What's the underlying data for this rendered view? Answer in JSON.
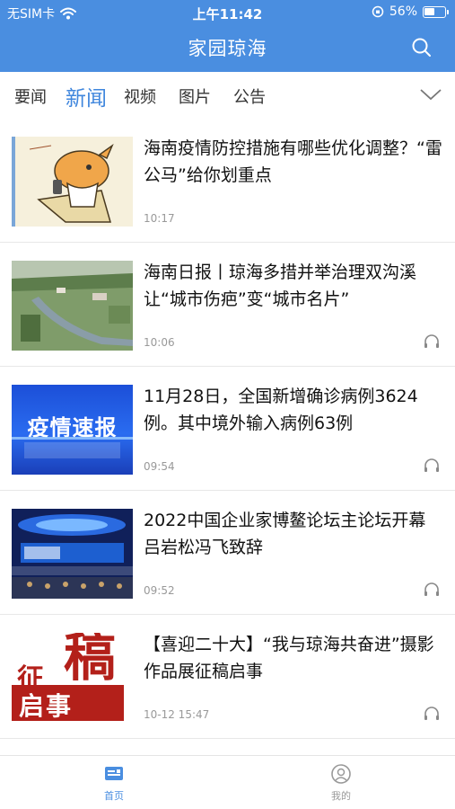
{
  "status_bar": {
    "carrier": "无SIM卡",
    "time": "上午11:42",
    "battery": "56%",
    "battery_level": 0.56
  },
  "header": {
    "title": "家园琼海"
  },
  "tabs": [
    {
      "label": "要闻",
      "active": false
    },
    {
      "label": "新闻",
      "active": true
    },
    {
      "label": "视频",
      "active": false
    },
    {
      "label": "图片",
      "active": false
    },
    {
      "label": "公告",
      "active": false
    }
  ],
  "news": [
    {
      "title": "海南疫情防控措施有哪些优化调整？“雷公马”给你划重点",
      "time": "10:17",
      "audio": false,
      "thumb_text": ""
    },
    {
      "title": "海南日报丨琼海多措并举治理双沟溪 让“城市伤疤”变“城市名片”",
      "time": "10:06",
      "audio": true,
      "thumb_text": ""
    },
    {
      "title": "11月28日，全国新增确诊病例3624例。其中境外输入病例63例",
      "time": "09:54",
      "audio": true,
      "thumb_text": "疫情速报"
    },
    {
      "title": "2022中国企业家博鳌论坛主论坛开幕 吕岩松冯飞致辞",
      "time": "09:52",
      "audio": true,
      "thumb_text": ""
    },
    {
      "title": "【喜迎二十大】“我与琼海共奋进”摄影作品展征稿启事",
      "time": "10-12 15:47",
      "audio": true,
      "thumb_text_1": "稿",
      "thumb_text_2": "征",
      "thumb_text_3": "启事"
    }
  ],
  "tabbar": [
    {
      "label": "首页",
      "active": true,
      "icon": "home-icon"
    },
    {
      "label": "我的",
      "active": false,
      "icon": "user-icon"
    }
  ],
  "colors": {
    "brand": "#4a8ee0",
    "active_tab": "#3f86dd",
    "muted": "#999999"
  }
}
